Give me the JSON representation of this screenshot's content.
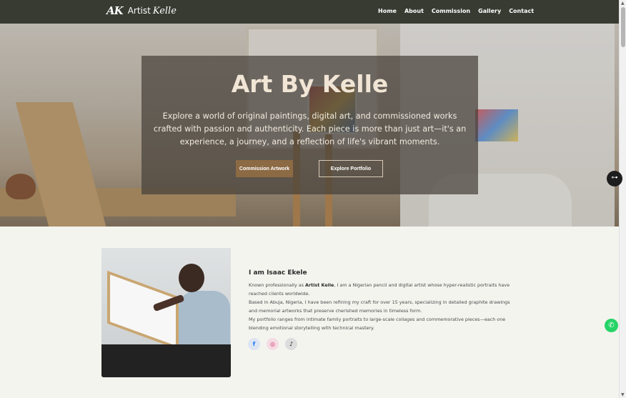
{
  "nav": {
    "logo_mark": "AK",
    "logo_text": "Artist",
    "logo_script": "Kelle",
    "links": [
      "Home",
      "About",
      "Commission",
      "Gallery",
      "Contact"
    ]
  },
  "hero": {
    "title": "Art By Kelle",
    "description": "Explore a world of original paintings, digital art, and commissioned works crafted with passion and authenticity. Each piece is more than just art—it's an experience, a journey, and a reflection of life's vibrant moments.",
    "btn_commission": "Commission Artwork",
    "btn_portfolio": "Explore Portfolio"
  },
  "about": {
    "heading": "I am Isaac Ekele",
    "p1_before": "Known professionally as ",
    "p1_bold": "Artist Kelle",
    "p1_after": ", I am a Nigerian pencil and digital artist whose hyper-realistic portraits have reached clients worldwide.",
    "p2": "Based in Abuja, Nigeria, I have been refining my craft for over 15 years, specializing in detailed graphite drawings and memorial artworks that preserve cherished memories in timeless form.",
    "p3": "My portfolio ranges from intimate family portraits to large-scale collages and commemorative pieces—each one blending emotional storytelling with technical mastery.",
    "socials": [
      "facebook",
      "instagram",
      "tiktok"
    ]
  },
  "icons": {
    "facebook": "f",
    "instagram": "◎",
    "tiktok": "♪",
    "toggle": "⊶",
    "whatsapp": "✆",
    "scroll_up": "▲",
    "scroll_down": "▼"
  },
  "colors": {
    "nav_bg": "#383b32",
    "accent_brown": "#8c6a44",
    "page_bg": "#f4f4ef",
    "whatsapp": "#25d366"
  }
}
